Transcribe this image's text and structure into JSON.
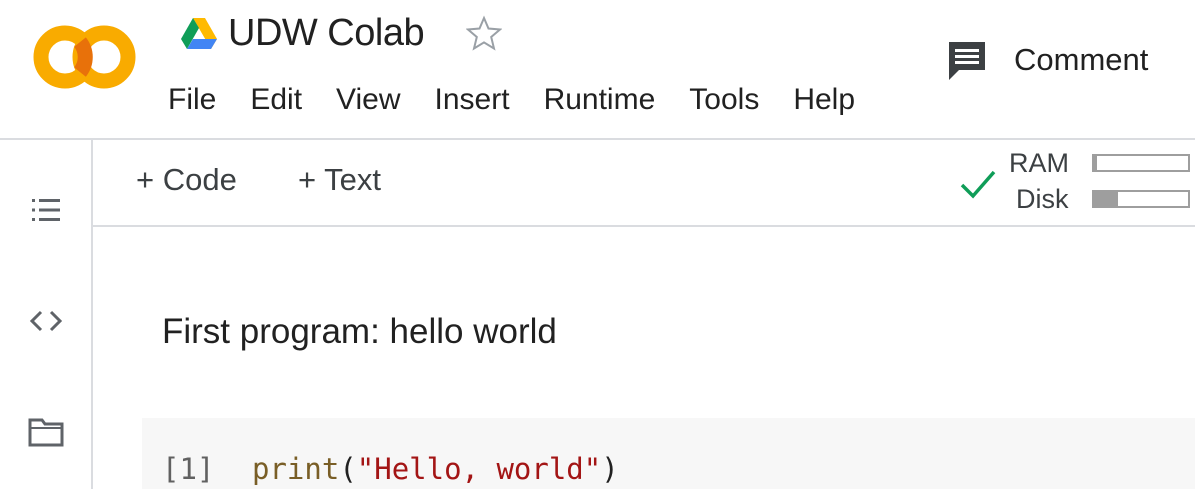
{
  "app": {
    "logo_text": "CO",
    "colors": {
      "logo_orange": "#F9AB00",
      "logo_orange_dark": "#E8710A",
      "check_green": "#0F9D58",
      "divider": "#dadce0"
    }
  },
  "header": {
    "title": "UDW Colab",
    "title_icon": "google-drive-icon",
    "star_icon": "star-outline-icon",
    "comment_label": "Comment",
    "comment_icon": "comment-icon"
  },
  "menu": {
    "items": [
      "File",
      "Edit",
      "View",
      "Insert",
      "Runtime",
      "Tools",
      "Help"
    ]
  },
  "sidebar": {
    "icons": [
      "table-of-contents-icon",
      "code-snippets-icon",
      "files-folder-icon"
    ]
  },
  "toolbar": {
    "add_code_label": "+ Code",
    "add_text_label": "+ Text",
    "connected_icon": "checkmark-icon",
    "ram_label": "RAM",
    "disk_label": "Disk",
    "ram_usage": 0.03,
    "disk_usage": 0.25
  },
  "notebook": {
    "text_cell": "First program: hello world",
    "code_cell": {
      "execution_count": "[1]",
      "code": {
        "func": "print",
        "open": "(",
        "string": "\"Hello, world\"",
        "close": ")"
      }
    }
  }
}
